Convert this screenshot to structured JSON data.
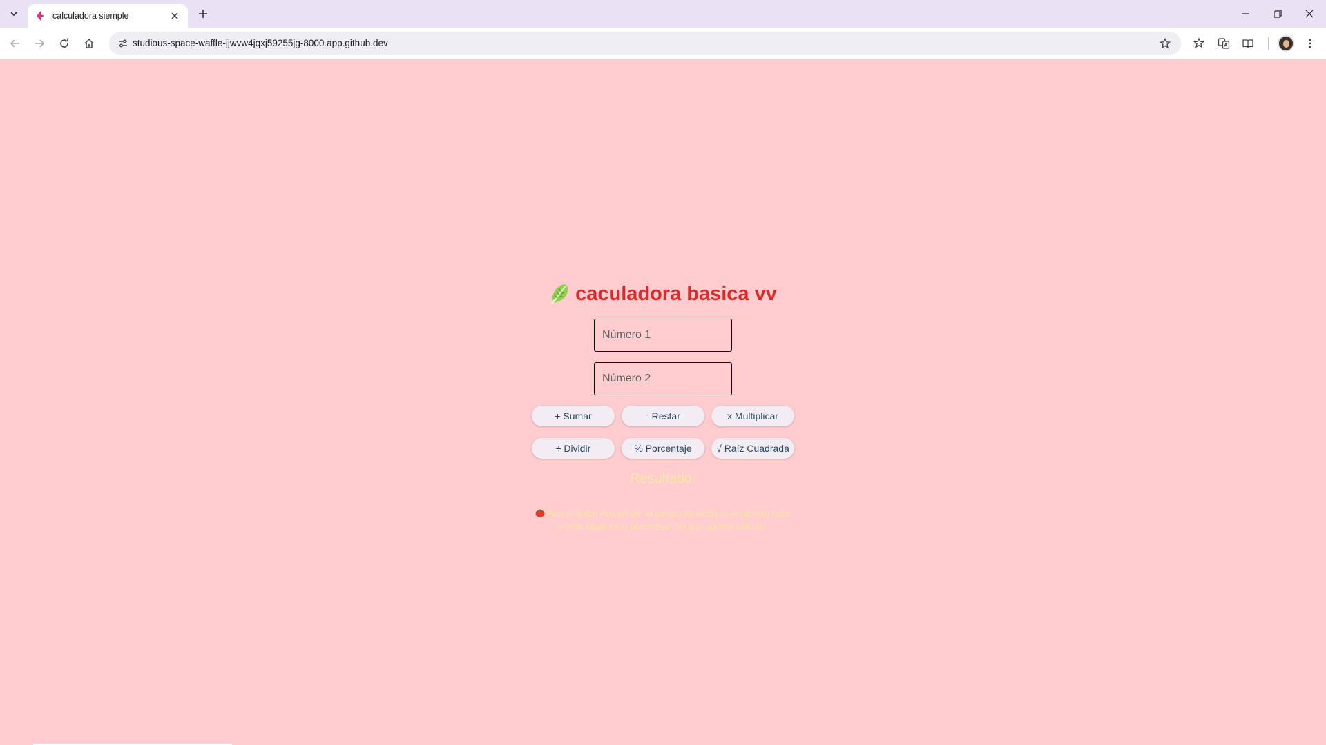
{
  "browser": {
    "tab": {
      "title": "calculadora siemple",
      "favicon": "bird-logo-icon"
    },
    "url": "studious-space-waffle-jjwvw4jqxj59255jg-8000.app.github.dev",
    "icons": {
      "tab_list": "chevron-down-icon",
      "tab_close": "close-icon",
      "new_tab": "plus-icon",
      "minimize": "minimize-icon",
      "restore": "restore-icon",
      "close_window": "close-icon",
      "back": "arrow-left-icon",
      "forward": "arrow-right-icon",
      "reload": "reload-icon",
      "home": "home-icon",
      "site_info": "tune-icon",
      "bookmark": "star-icon",
      "favorites": "star-list-icon",
      "translate": "translate-icon",
      "reading_mode": "book-icon",
      "menu": "kebab-menu-icon"
    }
  },
  "page": {
    "title_emoji": "lettuce-icon",
    "title": "caculadora basica vv",
    "input1_placeholder": "Número 1",
    "input2_placeholder": "Número 2",
    "buttons_row1": [
      "+ Sumar",
      "- Restar",
      "x Multiplicar"
    ],
    "buttons_row2": [
      "÷ Dividir",
      "% Porcentaje",
      "√ Raíz Cuadrada"
    ],
    "result_label": "Resultado:",
    "note_emoji": "tomato-icon",
    "note": "Para el botón Porcentaje: el campo de arriba es el número base y el de abajo es el porcentaje (%) que quieres calcular."
  },
  "colors": {
    "background": "#ffcccf",
    "title": "#d92b2b",
    "result": "#f7e9a0",
    "button_bg": "#f2edf3",
    "button_text": "#2b4a67"
  }
}
